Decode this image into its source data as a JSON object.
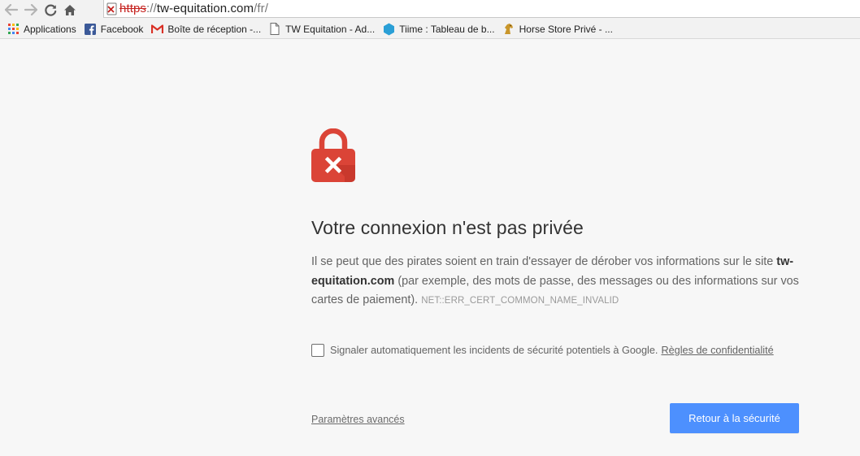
{
  "toolbar": {
    "back_icon": "arrow-left-icon",
    "forward_icon": "arrow-right-icon",
    "reload_icon": "reload-icon",
    "home_icon": "home-icon",
    "url": {
      "scheme": "https",
      "separator": "://",
      "host": "tw-equitation.com",
      "path": "/fr/"
    }
  },
  "bookmarks": [
    {
      "label": "Applications",
      "icon": "apps-grid-icon"
    },
    {
      "label": "Facebook",
      "icon": "facebook-icon"
    },
    {
      "label": "Boîte de réception -...",
      "icon": "gmail-icon"
    },
    {
      "label": "TW Equitation - Ad...",
      "icon": "page-icon"
    },
    {
      "label": "Tiime : Tableau de b...",
      "icon": "tiime-icon"
    },
    {
      "label": "Horse Store Privé - ...",
      "icon": "horse-icon"
    }
  ],
  "interstitial": {
    "icon": "broken-lock-icon",
    "title": "Votre connexion n'est pas privée",
    "body_part1": "Il se peut que des pirates soient en train d'essayer de dérober vos informations sur le site",
    "body_domain": "tw-equitation.com",
    "body_part2": "(par exemple, des mots de passe, des messages ou des informations sur vos cartes de paiement).",
    "error_code": "NET::ERR_CERT_COMMON_NAME_INVALID",
    "report_label": "Signaler automatiquement les incidents de sécurité potentiels à Google.",
    "privacy_link": "Règles de confidentialité",
    "report_checked": false,
    "advanced_link": "Paramètres avancés",
    "primary_button": "Retour à la sécurité"
  },
  "colors": {
    "accent_blue": "#4d90fe",
    "lock_red": "#db4437",
    "error_red": "#c5221f",
    "background": "#f7f7f7"
  }
}
